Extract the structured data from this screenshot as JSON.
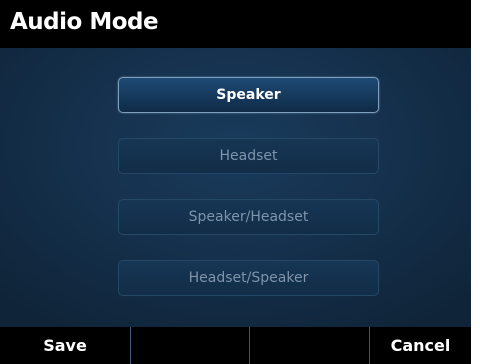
{
  "title": "Audio Mode",
  "options": [
    {
      "label": "Speaker",
      "selected": true
    },
    {
      "label": "Headset",
      "selected": false
    },
    {
      "label": "Speaker/Headset",
      "selected": false
    },
    {
      "label": "Headset/Speaker",
      "selected": false
    }
  ],
  "softkeys": {
    "key1": "Save",
    "key2": "",
    "key3": "",
    "key4": "Cancel"
  },
  "colors": {
    "background": "#142f4a",
    "bar": "#000000",
    "selected_text": "#ffffff",
    "unselected_text": "#7d94ab"
  }
}
